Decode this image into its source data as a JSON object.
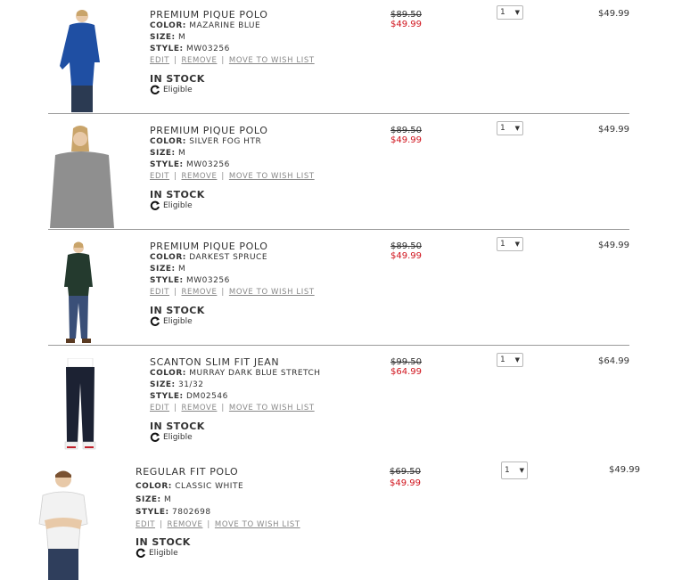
{
  "labels": {
    "color": "COLOR:",
    "size": "SIZE:",
    "style": "STYLE:",
    "edit": "EDIT",
    "remove": "REMOVE",
    "wishlist": "MOVE TO WISH LIST",
    "stock": "IN STOCK",
    "eligible": "Eligible"
  },
  "items": [
    {
      "name": "PREMIUM PIQUE POLO",
      "color": "MAZARINE BLUE",
      "size": "M",
      "style": "MW03256",
      "original_price": "$89.50",
      "sale_price": "$49.99",
      "qty": "1",
      "total": "$49.99",
      "shirt_color": "#1f4fa3",
      "pants_color": "#2b3a52"
    },
    {
      "name": "PREMIUM PIQUE POLO",
      "color": "SILVER FOG HTR",
      "size": "M",
      "style": "MW03256",
      "original_price": "$89.50",
      "sale_price": "$49.99",
      "qty": "1",
      "total": "$49.99",
      "shirt_color": "#8f8f8f",
      "pants_color": "#8f8f8f"
    },
    {
      "name": "PREMIUM PIQUE POLO",
      "color": "DARKEST SPRUCE",
      "size": "M",
      "style": "MW03256",
      "original_price": "$89.50",
      "sale_price": "$49.99",
      "qty": "1",
      "total": "$49.99",
      "shirt_color": "#243a2e",
      "pants_color": "#3a4f78"
    },
    {
      "name": "SCANTON SLIM FIT JEAN",
      "color": "MURRAY DARK BLUE STRETCH",
      "size": "31/32",
      "style": "DM02546",
      "original_price": "$99.50",
      "sale_price": "$64.99",
      "qty": "1",
      "total": "$64.99",
      "shirt_color": "#ffffff",
      "pants_color": "#1c2233"
    },
    {
      "name": "REGULAR FIT POLO",
      "color": "CLASSIC WHITE",
      "size": "M",
      "style": "7802698",
      "original_price": "$69.50",
      "sale_price": "$49.99",
      "qty": "1",
      "total": "$49.99",
      "shirt_color": "#f2f2f2",
      "pants_color": "#2f3e5c"
    }
  ]
}
